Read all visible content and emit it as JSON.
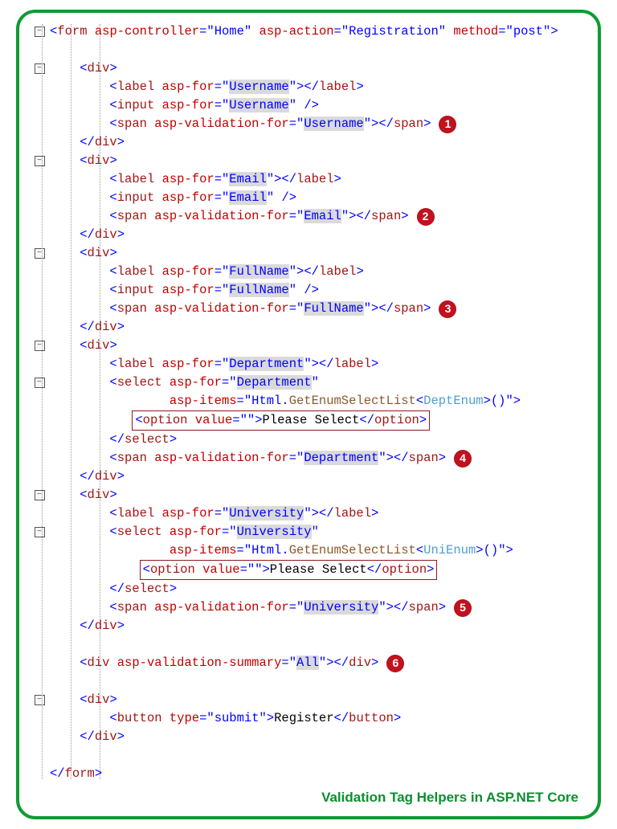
{
  "footer": "Validation Tag Helpers in ASP.NET Core",
  "fold": {
    "minus": "−"
  },
  "kw": {
    "form": "form",
    "div": "div",
    "label": "label",
    "input": "input",
    "span": "span",
    "select": "select",
    "option": "option",
    "button": "button"
  },
  "attr": {
    "asp_controller": "asp-controller",
    "asp_action": "asp-action",
    "method": "method",
    "asp_for": "asp-for",
    "asp_validation_for": "asp-validation-for",
    "asp_items": "asp-items",
    "asp_validation_summary": "asp-validation-summary",
    "value": "value",
    "type": "type"
  },
  "val": {
    "controller": "Home",
    "action": "Registration",
    "method": "post",
    "username": "Username",
    "email": "Email",
    "fullname": "FullName",
    "department": "Department",
    "university": "University",
    "all": "All",
    "submit": "submit",
    "empty": ""
  },
  "txt": {
    "please_select": "Please Select",
    "register": "Register"
  },
  "items": {
    "prefix": "Html",
    "member": "GetEnumSelectList",
    "dept_type": "DeptEnum",
    "uni_type": "UniEnum",
    "call": "()"
  },
  "badges": {
    "b1": "1",
    "b2": "2",
    "b3": "3",
    "b4": "4",
    "b5": "5",
    "b6": "6"
  }
}
